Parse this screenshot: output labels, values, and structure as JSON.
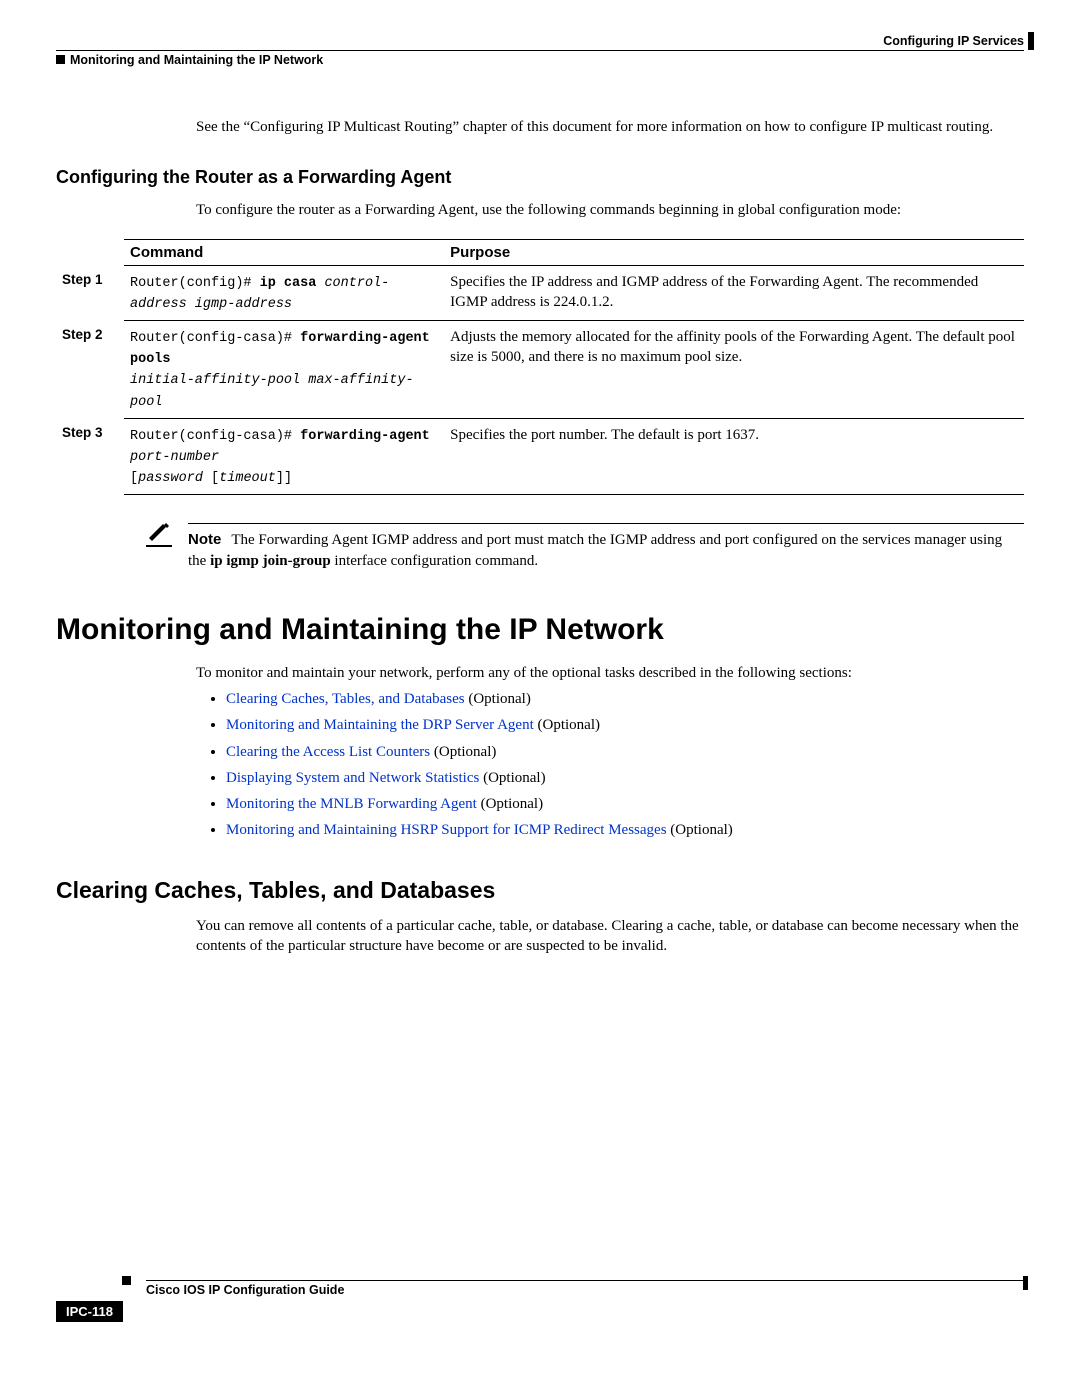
{
  "header": {
    "right": "Configuring IP Services",
    "left": "Monitoring and Maintaining the IP Network"
  },
  "intro_para": "See the “Configuring IP Multicast Routing” chapter of this document for more information on how to configure IP multicast routing.",
  "section1": {
    "title": "Configuring the Router as a Forwarding Agent",
    "para": "To configure the router as a Forwarding Agent, use the following commands beginning in global configuration mode:"
  },
  "table": {
    "head_cmd": "Command",
    "head_purpose": "Purpose",
    "rows": [
      {
        "step": "Step 1",
        "cmd_prefix": "Router(config)# ",
        "cmd_bold": "ip casa",
        "cmd_args": " control-address igmp-address",
        "purpose": "Specifies the IP address and IGMP address of the Forwarding Agent. The recommended IGMP address is 224.0.1.2."
      },
      {
        "step": "Step 2",
        "cmd_prefix": "Router(config-casa)# ",
        "cmd_bold": "forwarding-agent pools",
        "cmd_args_line2": "initial-affinity-pool max-affinity-pool",
        "purpose": "Adjusts the memory allocated for the affinity pools of the Forwarding Agent. The default pool size is 5000, and there is no maximum pool size."
      },
      {
        "step": "Step 3",
        "cmd_prefix": "Router(config-casa)# ",
        "cmd_bold": "forwarding-agent",
        "cmd_args": " port-number",
        "cmd_line2_plain": "[",
        "cmd_line2_args": "password ",
        "cmd_line2_plain2": "[",
        "cmd_line2_args2": "timeout",
        "cmd_line2_plain3": "]]",
        "purpose": "Specifies the port number. The default is port 1637."
      }
    ]
  },
  "note": {
    "label": "Note",
    "text_before": "The Forwarding Agent IGMP address and port must match the IGMP address and port configured on the services manager using the ",
    "bold": "ip igmp join-group",
    "text_after": " interface configuration command."
  },
  "section2": {
    "title": "Monitoring and Maintaining the IP Network",
    "para": "To monitor and maintain your network, perform any of the optional tasks described in the following sections:",
    "items": [
      {
        "link": "Clearing Caches, Tables, and Databases",
        "suffix": " (Optional)"
      },
      {
        "link": "Monitoring and Maintaining the DRP Server Agent",
        "suffix": " (Optional)"
      },
      {
        "link": "Clearing the Access List Counters",
        "suffix": " (Optional)"
      },
      {
        "link": "Displaying System and Network Statistics",
        "suffix": " (Optional)"
      },
      {
        "link": "Monitoring the MNLB Forwarding Agent",
        "suffix": " (Optional)"
      },
      {
        "link": "Monitoring and Maintaining HSRP Support for ICMP Redirect Messages",
        "suffix": " (Optional)"
      }
    ]
  },
  "section3": {
    "title": "Clearing Caches, Tables, and Databases",
    "para": "You can remove all contents of a particular cache, table, or database. Clearing a cache, table, or database can become necessary when the contents of the particular structure have become or are suspected to be invalid."
  },
  "footer": {
    "title": "Cisco IOS IP Configuration Guide",
    "pagenum": "IPC-118"
  }
}
